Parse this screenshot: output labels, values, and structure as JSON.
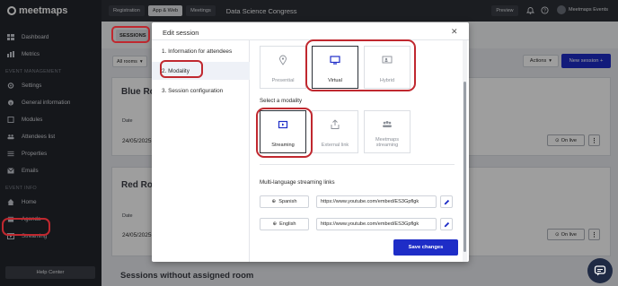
{
  "brand": "meetmaps",
  "sidebar": {
    "top_items": [
      {
        "label": "Dashboard",
        "icon": "dashboard-icon"
      },
      {
        "label": "Metrics",
        "icon": "chart-icon"
      }
    ],
    "section_event_management": "EVENT MANAGEMENT",
    "management_items": [
      {
        "label": "Settings",
        "icon": "gear-icon"
      },
      {
        "label": "General information",
        "icon": "info-icon"
      },
      {
        "label": "Modules",
        "icon": "modules-icon"
      },
      {
        "label": "Attendees list",
        "icon": "people-icon"
      },
      {
        "label": "Properties",
        "icon": "properties-icon"
      },
      {
        "label": "Emails",
        "icon": "mail-icon"
      }
    ],
    "section_event_info": "EVENT INFO",
    "info_items": [
      {
        "label": "Home",
        "icon": "home-icon"
      },
      {
        "label": "Agenda",
        "icon": "calendar-icon"
      },
      {
        "label": "Streaming",
        "icon": "video-icon"
      }
    ],
    "help_center": "Help Center"
  },
  "topbar": {
    "tabs": [
      "Registration",
      "App & Web",
      "Meetings"
    ],
    "active_tab": "App & Web",
    "event_title": "Data Science Congress",
    "preview": "Preview",
    "user_name": "Meetmaps Events"
  },
  "main": {
    "sessions_label": "SESSIONS",
    "filter_label": "All rooms",
    "actions_label": "Actions",
    "new_session_label": "New session +",
    "rooms": [
      {
        "title": "Blue Room",
        "col_date": "Date",
        "date": "24/05/2025",
        "on_live": "On live"
      },
      {
        "title": "Red Room",
        "col_date": "Date",
        "date": "24/05/2025",
        "on_live": "On live"
      }
    ],
    "no_room_title": "Sessions without assigned room"
  },
  "modal": {
    "title": "Edit session",
    "steps": [
      "1. Information for attendees",
      "2. Modality",
      "3. Session configuration"
    ],
    "active_step": 1,
    "types": [
      {
        "label": "Presential",
        "icon": "location-pin-icon",
        "selected": false
      },
      {
        "label": "Virtual",
        "icon": "monitor-icon",
        "selected": true
      },
      {
        "label": "Hybrid",
        "icon": "hybrid-icon",
        "selected": false
      }
    ],
    "modality_heading": "Select a modality",
    "modalities": [
      {
        "label": "Streaming",
        "icon": "streaming-icon",
        "selected": true
      },
      {
        "label": "External link",
        "icon": "external-link-icon",
        "selected": false
      },
      {
        "label": "Meetmaps streaming",
        "icon": "group-icon",
        "selected": false
      }
    ],
    "links_heading": "Multi-language streaming links",
    "links": [
      {
        "language": "Spanish",
        "url": "https://www.youtube.com/embed/ES3Gpflgk"
      },
      {
        "language": "English",
        "url": "https://www.youtube.com/embed/ES3Gpflgk"
      }
    ],
    "save_label": "Save changes"
  },
  "colors": {
    "accent": "#1e2dc7",
    "highlight": "#c0282f",
    "sidebar_bg": "#23262c"
  }
}
